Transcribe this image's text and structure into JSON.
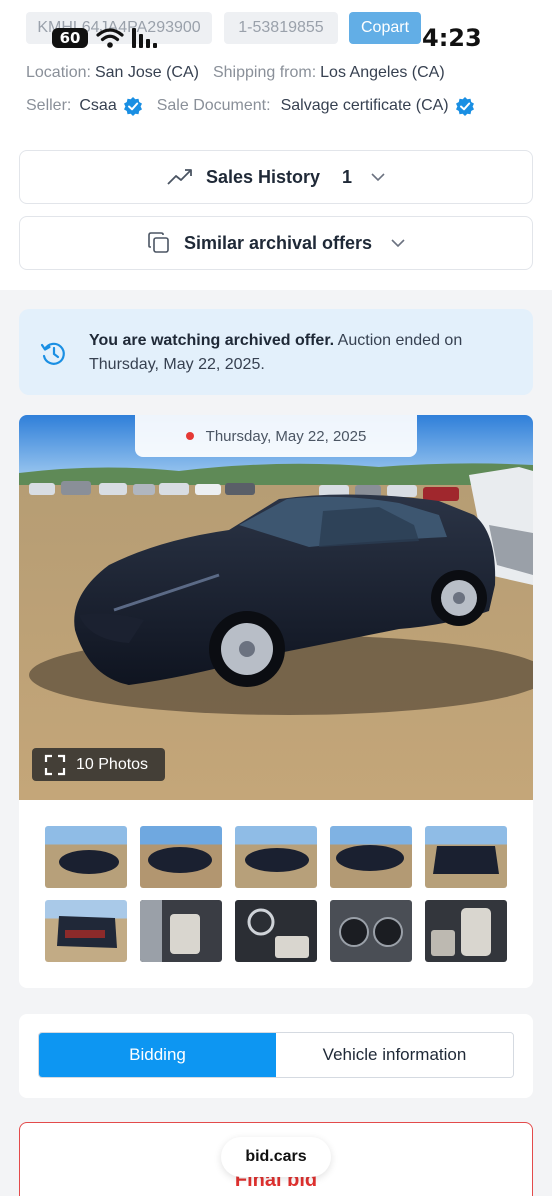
{
  "header": {
    "vin": "KMHL64JA4PA293900",
    "lot_number": "1-53819855",
    "auction_badge": "Copart"
  },
  "status_bar": {
    "signal_badge": "60",
    "time": "4:23"
  },
  "details": {
    "location_label": "Location:",
    "location_value": "San Jose (CA)",
    "shipping_label": "Shipping from:",
    "shipping_value": "Los Angeles (CA)",
    "seller_label": "Seller:",
    "seller_value": "Csaa",
    "sale_doc_label": "Sale Document:",
    "sale_doc_value": "Salvage certificate (CA)"
  },
  "sales_history": {
    "label": "Sales History",
    "count": "1"
  },
  "similar": {
    "label": "Similar archival offers"
  },
  "archived_notice": {
    "bold": "You are watching archived offer.",
    "rest": " Auction ended on Thursday, May 22, 2025."
  },
  "gallery": {
    "date": "Thursday, May 22, 2025",
    "photos_label": "10 Photos"
  },
  "tabs": {
    "bidding": "Bidding",
    "vehicle_info": "Vehicle information"
  },
  "final_bid": {
    "label": "Final bid"
  },
  "floating_badge": {
    "label": "bid.cars"
  },
  "colors": {
    "accent": "#0d96f2",
    "copart": "#62aee6",
    "final_bid_red": "#e0312f",
    "notice_bg": "#e3f0fb"
  }
}
